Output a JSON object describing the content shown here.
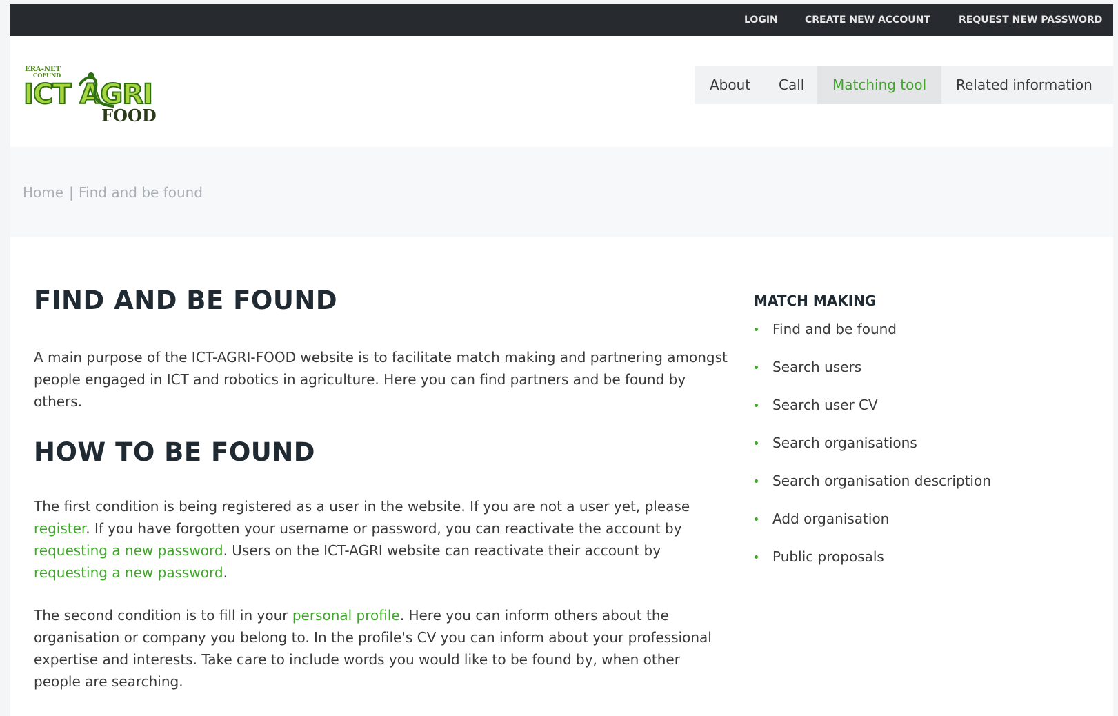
{
  "topbar": {
    "login": "LOGIN",
    "create_account": "CREATE NEW ACCOUNT",
    "request_password": "REQUEST NEW PASSWORD"
  },
  "logo": {
    "top_text": "ERA-NET",
    "sub_text": "COFUND",
    "main_text": "ICT AGRI",
    "bottom_text": "FOOD"
  },
  "nav": {
    "items": [
      {
        "label": "About",
        "active": false
      },
      {
        "label": "Call",
        "active": false
      },
      {
        "label": "Matching tool",
        "active": true
      },
      {
        "label": "Related information",
        "active": false
      }
    ]
  },
  "breadcrumb": {
    "home": "Home",
    "separator": "|",
    "current": "Find and be found"
  },
  "main": {
    "title": "FIND AND BE FOUND",
    "intro": "A main purpose of the ICT-AGRI-FOOD website is to facilitate match making and partnering amongst people engaged in ICT and robotics in agriculture. Here you can find partners and be found by others.",
    "section_title": "HOW TO BE FOUND",
    "p1": {
      "t1": "The first condition is being registered as a user in the website. If you are not a user yet, please ",
      "link_register": "register",
      "t2": ". If you have forgotten your username or password, you can reactivate the account by ",
      "link_password_1": "requesting a new password",
      "t3": ". Users on the ICT-AGRI website can reactivate their account by ",
      "link_password_2": "requesting a new password",
      "t4": "."
    },
    "p2": {
      "t1": "The second condition is to fill in your ",
      "link_profile": "personal profile",
      "t2": ". Here you can inform others about the organisation or company you belong to. In the profile's CV you can inform about your professional expertise and interests. Take care to include words you would like to be found by, when other people are searching."
    }
  },
  "sidebar": {
    "title": "MATCH MAKING",
    "items": [
      "Find and be found",
      "Search users",
      "Search user CV",
      "Search organisations",
      "Search organisation description",
      "Add organisation",
      "Public proposals"
    ]
  },
  "colors": {
    "accent": "#3fa62a",
    "topbar": "#272a2e",
    "heading": "#1f2a33",
    "breadcrumb": "#a9b0b5"
  }
}
